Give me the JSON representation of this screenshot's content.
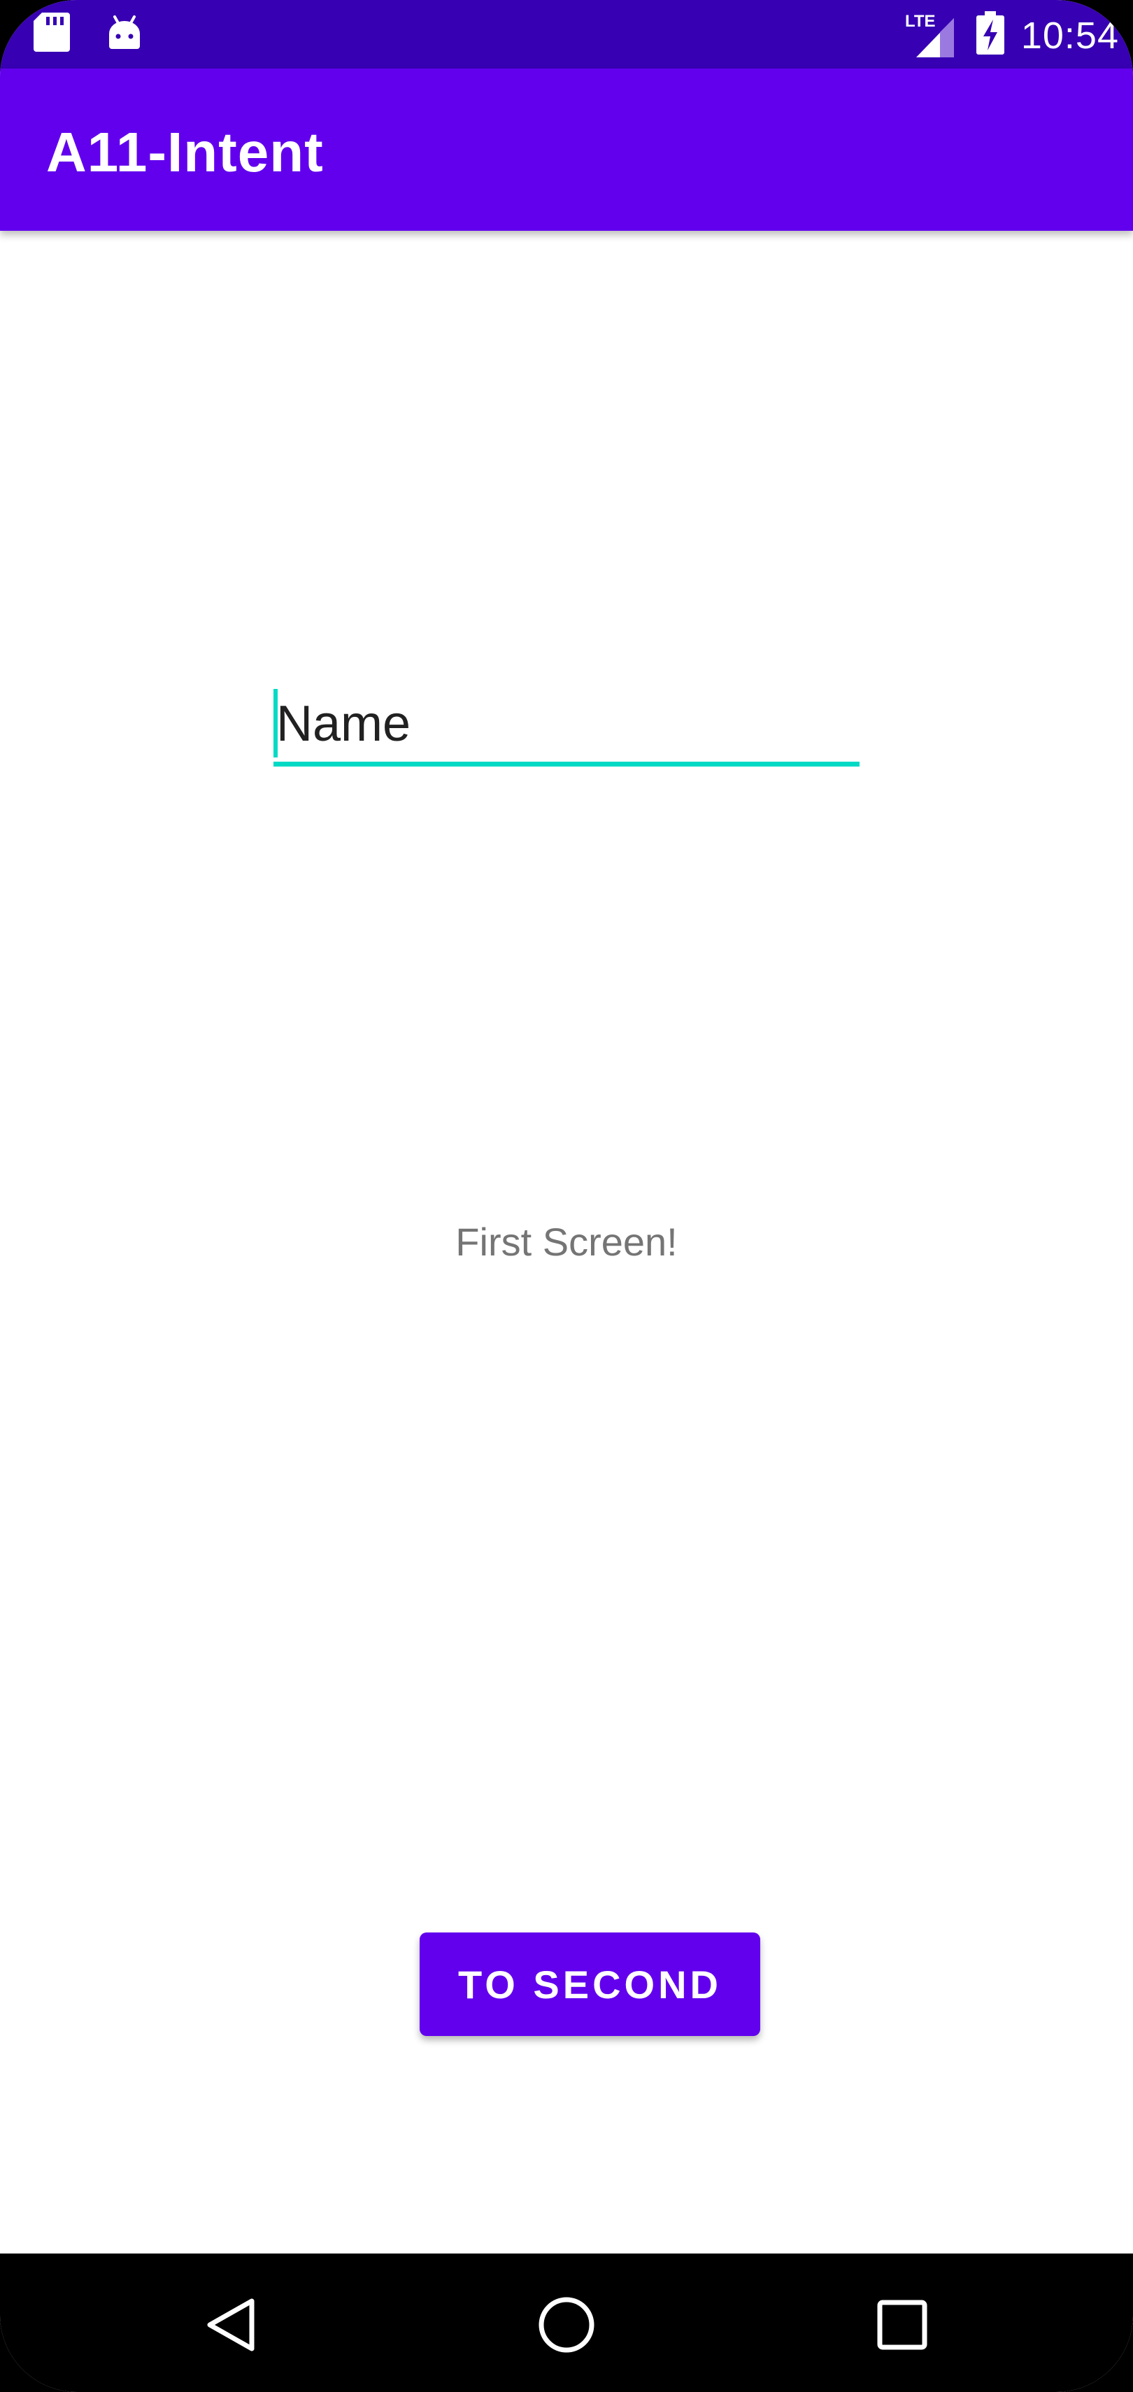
{
  "status_bar": {
    "time": "10:54",
    "network": "LTE",
    "icons": [
      "sd-card-icon",
      "android-icon",
      "signal-icon",
      "battery-charging-icon"
    ],
    "color": "#3700B3"
  },
  "app_bar": {
    "title": "A11-Intent",
    "color": "#6200EE"
  },
  "form": {
    "name_placeholder": "Name",
    "name_value": "",
    "accent_color": "#03DAC5"
  },
  "body": {
    "label": "First Screen!"
  },
  "actions": {
    "to_second_label": "TO SECOND",
    "button_color": "#6200EE"
  },
  "nav_bar": {
    "icons": [
      "back-icon",
      "home-icon",
      "recents-icon"
    ]
  }
}
